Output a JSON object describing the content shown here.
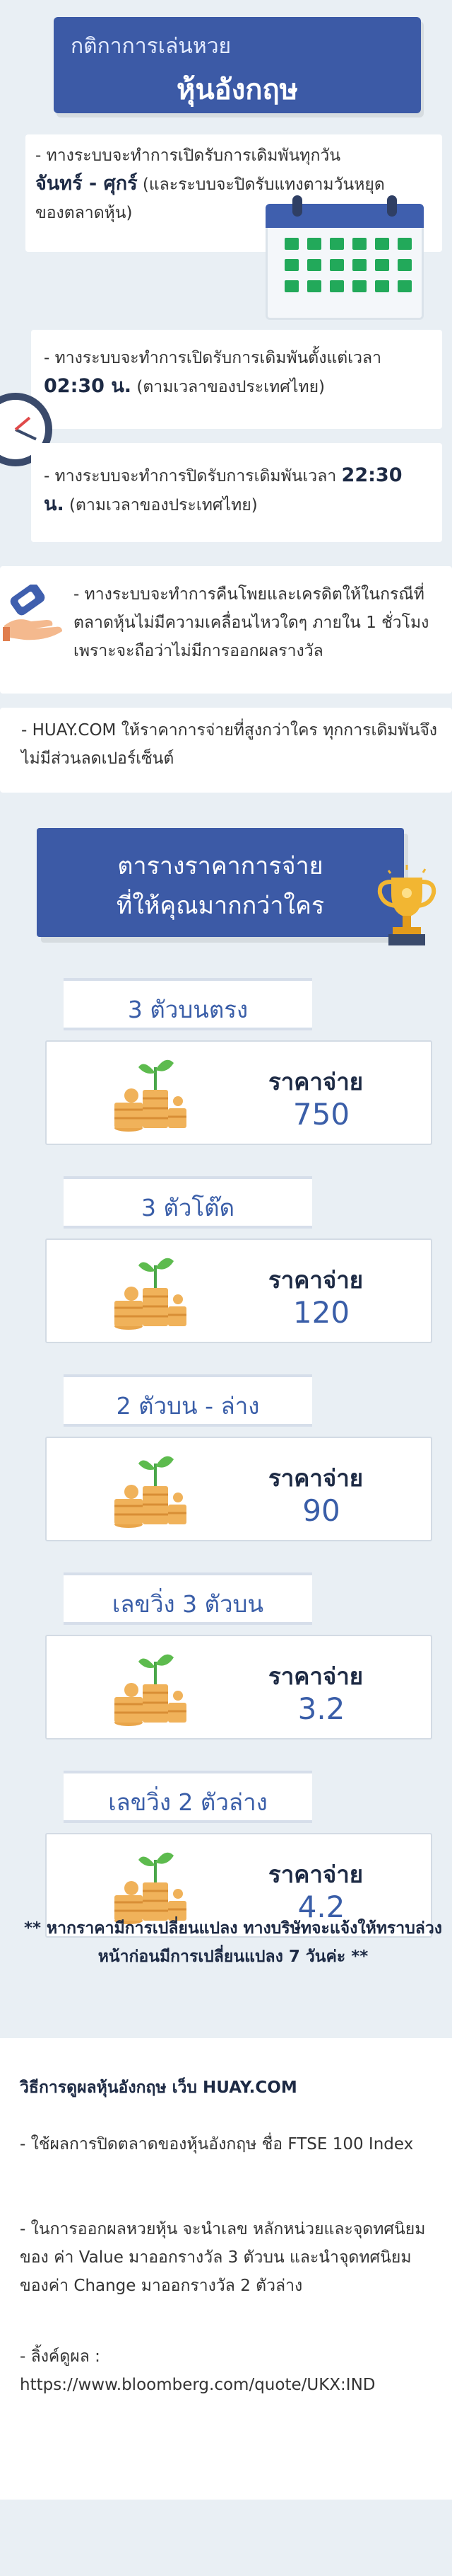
{
  "header": {
    "subtitle": "กติกาการเล่นหวย",
    "title": "หุ้นอังกฤษ"
  },
  "rules": [
    {
      "prefix": "-    ทางระบบจะทำการเปิดรับการเดิมพันทุกวัน",
      "bold": "จันทร์ - ศุกร์",
      "suffix": " (และระบบจะปิดรับแทงตามวันหยุดของตลาดหุ้น)"
    },
    {
      "prefix": "-    ทางระบบจะทำการเปิดรับการเดิมพันตั้งแต่เวลา ",
      "bold": "02:30 น.",
      "suffix": " (ตามเวลาของประเทศไทย)"
    },
    {
      "prefix": "-    ทางระบบจะทำการปิดรับการเดิมพันเวลา ",
      "bold": "22:30 น.",
      "suffix": " (ตามเวลาของประเทศไทย)"
    },
    {
      "text": "-    ทางระบบจะทำการคืนโพยและเครดิตให้ในกรณีที่ตลาดหุ้นไม่มีความเคลื่อนไหวใดๆ ภายใน 1 ชั่วโมง เพราะจะถือว่าไม่มีการออกผลรางวัล"
    },
    {
      "text": "-    HUAY.COM ให้ราคาการจ่ายที่สูงกว่าใคร ทุกการเดิมพันจึงไม่มีส่วนลดเปอร์เซ็นต์"
    }
  ],
  "payout": {
    "header_line1": "ตารางราคาการจ่าย",
    "header_line2": "ที่ให้คุณมากกว่าใคร",
    "items": [
      {
        "name": "3 ตัวบนตรง",
        "label": "ราคาจ่าย",
        "value": "750"
      },
      {
        "name": "3 ตัวโต๊ด",
        "label": "ราคาจ่าย",
        "value": "120"
      },
      {
        "name": "2 ตัวบน - ล่าง",
        "label": "ราคาจ่าย",
        "value": "90"
      },
      {
        "name": "เลขวิ่ง 3 ตัวบน",
        "label": "ราคาจ่าย",
        "value": "3.2"
      },
      {
        "name": "เลขวิ่ง 2 ตัวล่าง",
        "label": "ราคาจ่าย",
        "value": "4.2"
      }
    ],
    "notice": "** หากราคามีการเปลี่ยนแปลง ทางบริษัทจะแจ้งให้ทราบล่วงหน้าก่อนมีการเปลี่ยนแปลง 7 วันค่ะ **"
  },
  "howto": {
    "title": "วิธีการดูผลหุ้นอังกฤษ เว็บ HUAY.COM",
    "p1": "       -    ใช้ผลการปิดตลาดของหุ้นอังกฤษ ชื่อ FTSE 100 Index",
    "p2": "       -    ในการออกผลหวยหุ้น จะนำเลข หลักหน่วยและจุดทศนิยมของ ค่า Value มาออกรางวัล 3 ตัวบน และนำจุดทศนิยมของค่า Change มาออกรางวัล 2 ตัวล่าง",
    "p3": "       -    ลิ้งค์ดูผล : https://www.bloomberg.com/quote/UKX:IND"
  },
  "colors": {
    "brand_blue": "#3c5aa6",
    "accent_text": "#3a5ea8",
    "green_cells": "#22a95a",
    "background": "#e9eff4"
  }
}
